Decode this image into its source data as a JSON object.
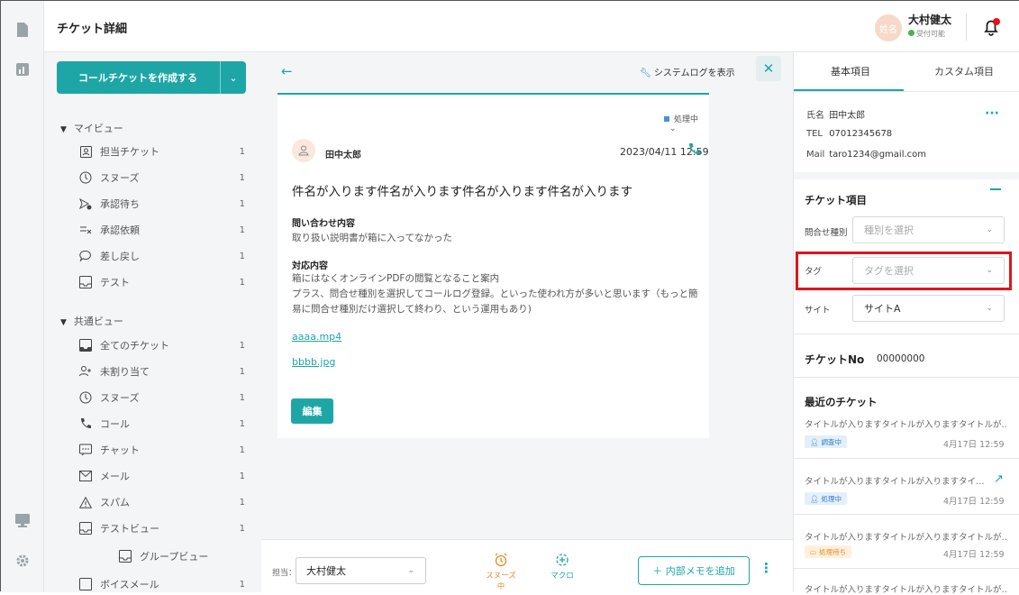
{
  "header": {
    "title": "チケット詳細"
  },
  "user": {
    "avatar_text": "姓名",
    "name": "大村健太",
    "status": "受付可能"
  },
  "sidebar": {
    "create_button": "コールチケットを作成する",
    "my_view": {
      "title": "マイビュー",
      "items": [
        {
          "label": "担当チケット",
          "count": "1"
        },
        {
          "label": "スヌーズ",
          "count": "1"
        },
        {
          "label": "承認待ち",
          "count": "1"
        },
        {
          "label": "承認依頼",
          "count": "1"
        },
        {
          "label": "差し戻し",
          "count": "1"
        },
        {
          "label": "テスト",
          "count": "1"
        }
      ]
    },
    "shared_view": {
      "title": "共通ビュー",
      "items": [
        {
          "label": "全てのチケット",
          "count": "1"
        },
        {
          "label": "未割り当て",
          "count": "1"
        },
        {
          "label": "スヌーズ",
          "count": "1"
        },
        {
          "label": "コール",
          "count": "1"
        },
        {
          "label": "チャット",
          "count": "1"
        },
        {
          "label": "メール",
          "count": "1"
        },
        {
          "label": "スパム",
          "count": "1"
        },
        {
          "label": "テストビュー",
          "count": "1"
        },
        {
          "label": "グループビュー",
          "count": ""
        },
        {
          "label": "ボイスメール",
          "count": "1"
        }
      ]
    }
  },
  "ticket": {
    "system_log": "システムログを表示",
    "status": "処理中",
    "customer": "田中太郎",
    "datetime": "2023/04/11 12:59",
    "subject": "件名が入ります件名が入ります件名が入ります件名が入ります",
    "inquiry_label": "問い合わせ内容",
    "inquiry_text": "取り扱い説明書が箱に入ってなかった",
    "response_label": "対応内容",
    "response_lines": [
      "箱にはなくオンラインPDFの閲覧となること案内",
      "プラス、問合せ種別を選択してコールログ登録。といった使われ方が多いと思います（もっと簡",
      "易に問合せ種別だけ選択して終わり、という運用もあり)"
    ],
    "attachments": [
      "aaaa.mp4",
      "bbbb.jpg"
    ],
    "edit_button": "編集"
  },
  "bottom": {
    "assignee_label": "担当：",
    "assignee": "大村健太",
    "snooze": "スヌーズ中",
    "macro": "マクロ",
    "memo_button": "＋ 内部メモを追加"
  },
  "right": {
    "tabs": [
      "基本項目",
      "カスタム項目"
    ],
    "contact": {
      "name_label": "氏名",
      "name": "田中太郎",
      "tel_label": "TEL",
      "tel": "07012345678",
      "mail_label": "Mail",
      "mail": "taro1234@gmail.com"
    },
    "ticket_fields_title": "チケット項目",
    "fields": [
      {
        "label": "問合せ種別",
        "value": "種別を選択",
        "placeholder": true
      },
      {
        "label": "タグ",
        "value": "タグを選択",
        "placeholder": true
      },
      {
        "label": "サイト",
        "value": "サイトA",
        "placeholder": false
      }
    ],
    "ticket_no_label": "チケットNo",
    "ticket_no": "00000000",
    "recent_title": "最近のチケット",
    "recent": [
      {
        "title": "タイトルが入りますタイトルが入りますタイトルが…",
        "badge": "調査中",
        "date": "4月17日 12:59"
      },
      {
        "title": "タイトルが入りますタイトルが入りますタイ…",
        "badge": "処理中",
        "date": "4月17日 12:59"
      },
      {
        "title": "タイトルが入りますタイトルが入りますタイトルが…",
        "badge": "処理待ち",
        "date": "4月17日 12:59"
      },
      {
        "title": "タイトルが入りますタイトルが入りますタイトルが…"
      }
    ]
  },
  "colors": {
    "accent": "#1ea6a6",
    "highlight": "#e2141c",
    "snooze": "#f08a24"
  }
}
